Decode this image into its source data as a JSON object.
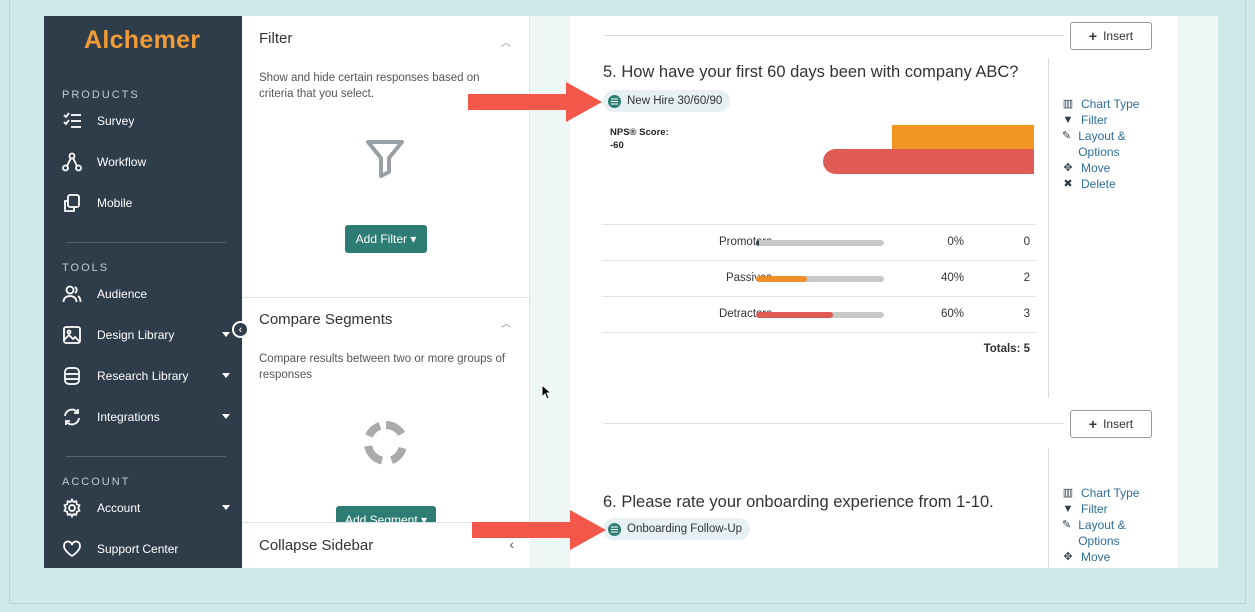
{
  "brand": {
    "name": "Alchemer",
    "accent": "#f19a38"
  },
  "sidebar": {
    "sections": [
      {
        "heading": "PRODUCTS",
        "items": [
          {
            "label": "Survey",
            "icon": "list-icon"
          },
          {
            "label": "Workflow",
            "icon": "workflow-icon"
          },
          {
            "label": "Mobile",
            "icon": "mobile-icon"
          }
        ]
      },
      {
        "heading": "TOOLS",
        "items": [
          {
            "label": "Audience",
            "icon": "audience-icon"
          },
          {
            "label": "Design Library",
            "icon": "image-icon"
          },
          {
            "label": "Research Library",
            "icon": "database-icon"
          },
          {
            "label": "Integrations",
            "icon": "sync-icon"
          }
        ]
      },
      {
        "heading": "ACCOUNT",
        "items": [
          {
            "label": "Account",
            "icon": "gear-icon"
          },
          {
            "label": "Support Center",
            "icon": "heart-icon"
          }
        ]
      }
    ]
  },
  "panel": {
    "filter": {
      "title": "Filter",
      "description": "Show and hide certain responses based on criteria that you select.",
      "button": "Add Filter ▾"
    },
    "compare": {
      "title": "Compare Segments",
      "description": "Compare results between two or more groups of responses",
      "button": "Add Segment ▾"
    },
    "collapse_label": "Collapse Sidebar"
  },
  "main": {
    "insert_label": "Insert",
    "question5": {
      "title": "5. How have your first 60 days been with company ABC?",
      "tag": "New Hire 30/60/90",
      "nps_label": "NPS® Score:",
      "nps_value": "-60",
      "rows": [
        {
          "label": "Promoters",
          "percent": "0%",
          "count": "0",
          "fraction": 0.0,
          "color": "#e8e8e8"
        },
        {
          "label": "Passives",
          "percent": "40%",
          "count": "2",
          "fraction": 0.4,
          "color": "#ef8f2b"
        },
        {
          "label": "Detractors",
          "percent": "60%",
          "count": "3",
          "fraction": 0.6,
          "color": "#e05b54"
        }
      ],
      "totals": "Totals: 5"
    },
    "question6": {
      "title": "6. Please rate your onboarding experience from 1-10.",
      "tag": "Onboarding Follow-Up"
    },
    "side_actions": {
      "chart_type": "Chart Type",
      "filter": "Filter",
      "layout": "Layout & Options",
      "move": "Move",
      "delete": "Delete"
    }
  },
  "colors": {
    "passive": "#f39523",
    "detractor": "#e05b54",
    "primary_button": "#2e7d74",
    "arrow": "#f2574a"
  }
}
